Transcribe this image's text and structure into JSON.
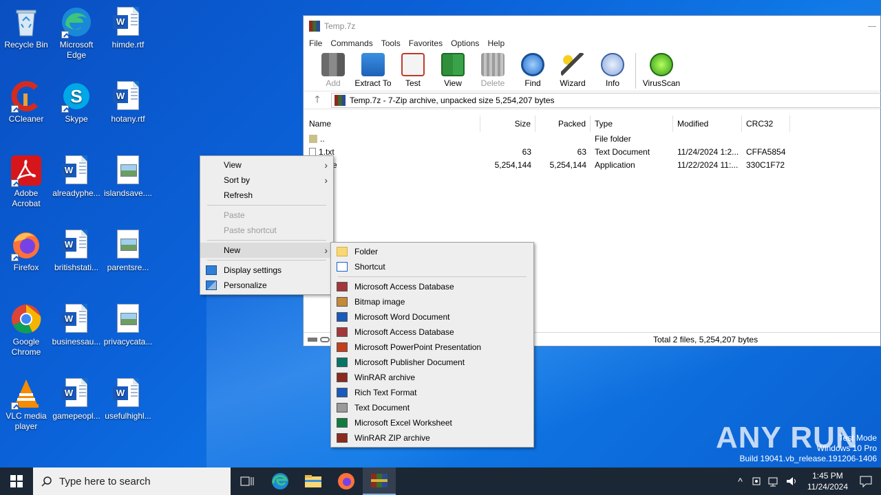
{
  "desktop": {
    "icons": [
      {
        "label": "Recycle Bin"
      },
      {
        "label": "Microsoft Edge"
      },
      {
        "label": "himde.rtf"
      },
      {
        "label": "CCleaner"
      },
      {
        "label": "Skype"
      },
      {
        "label": "hotany.rtf"
      },
      {
        "label": "Adobe Acrobat"
      },
      {
        "label": "alreadyphe..."
      },
      {
        "label": "islandsave...."
      },
      {
        "label": "Firefox"
      },
      {
        "label": "britishstati..."
      },
      {
        "label": "parentsre..."
      },
      {
        "label": "Google Chrome"
      },
      {
        "label": "businessau..."
      },
      {
        "label": "privacycata..."
      },
      {
        "label": "VLC media player"
      },
      {
        "label": "gamepeopl..."
      },
      {
        "label": "usefulhighl..."
      }
    ]
  },
  "zip_window": {
    "title": "Temp.7z",
    "menu": [
      "File",
      "Commands",
      "Tools",
      "Favorites",
      "Options",
      "Help"
    ],
    "toolbar": [
      "Add",
      "Extract To",
      "Test",
      "View",
      "Delete",
      "Find",
      "Wizard",
      "Info",
      "VirusScan"
    ],
    "address": "Temp.7z - 7-Zip archive, unpacked size 5,254,207 bytes",
    "columns": [
      "Name",
      "Size",
      "Packed",
      "Type",
      "Modified",
      "CRC32"
    ],
    "rows": [
      {
        "name": "..",
        "size": "",
        "packed": "",
        "type": "File folder",
        "modified": "",
        "crc": ""
      },
      {
        "name": "1.txt",
        "size": "63",
        "packed": "63",
        "type": "Text Document",
        "modified": "11/24/2024 1:2...",
        "crc": "CFFA5854"
      },
      {
        "name": "xe",
        "size": "5,254,144",
        "packed": "5,254,144",
        "type": "Application",
        "modified": "11/22/2024 11:...",
        "crc": "330C1F72"
      }
    ],
    "status": "Total 2 files, 5,254,207 bytes"
  },
  "context_menu": {
    "view": "View",
    "sort_by": "Sort by",
    "refresh": "Refresh",
    "paste": "Paste",
    "paste_shortcut": "Paste shortcut",
    "new": "New",
    "display_settings": "Display settings",
    "personalize": "Personalize"
  },
  "new_submenu": {
    "folder": "Folder",
    "shortcut": "Shortcut",
    "items": [
      {
        "label": "Microsoft Access Database",
        "color": "#a4373a"
      },
      {
        "label": "Bitmap image",
        "color": "#c48a3a"
      },
      {
        "label": "Microsoft Word Document",
        "color": "#185abd"
      },
      {
        "label": "Microsoft Access Database",
        "color": "#a4373a"
      },
      {
        "label": "Microsoft PowerPoint Presentation",
        "color": "#c43e1c"
      },
      {
        "label": "Microsoft Publisher Document",
        "color": "#077568"
      },
      {
        "label": "WinRAR archive",
        "color": "#8b2a1e"
      },
      {
        "label": "Rich Text Format",
        "color": "#185abd"
      },
      {
        "label": "Text Document",
        "color": "#9a9a9a"
      },
      {
        "label": "Microsoft Excel Worksheet",
        "color": "#107c41"
      },
      {
        "label": "WinRAR ZIP archive",
        "color": "#8b2a1e"
      }
    ]
  },
  "taskbar": {
    "search_placeholder": "Type here to search",
    "time": "1:45 PM",
    "date": "11/24/2024"
  },
  "watermark": {
    "brand": "ANY RUN",
    "line1": "Test Mode",
    "line2": "Windows 10 Pro",
    "line3": "Build 19041.vb_release.191206-1406"
  }
}
